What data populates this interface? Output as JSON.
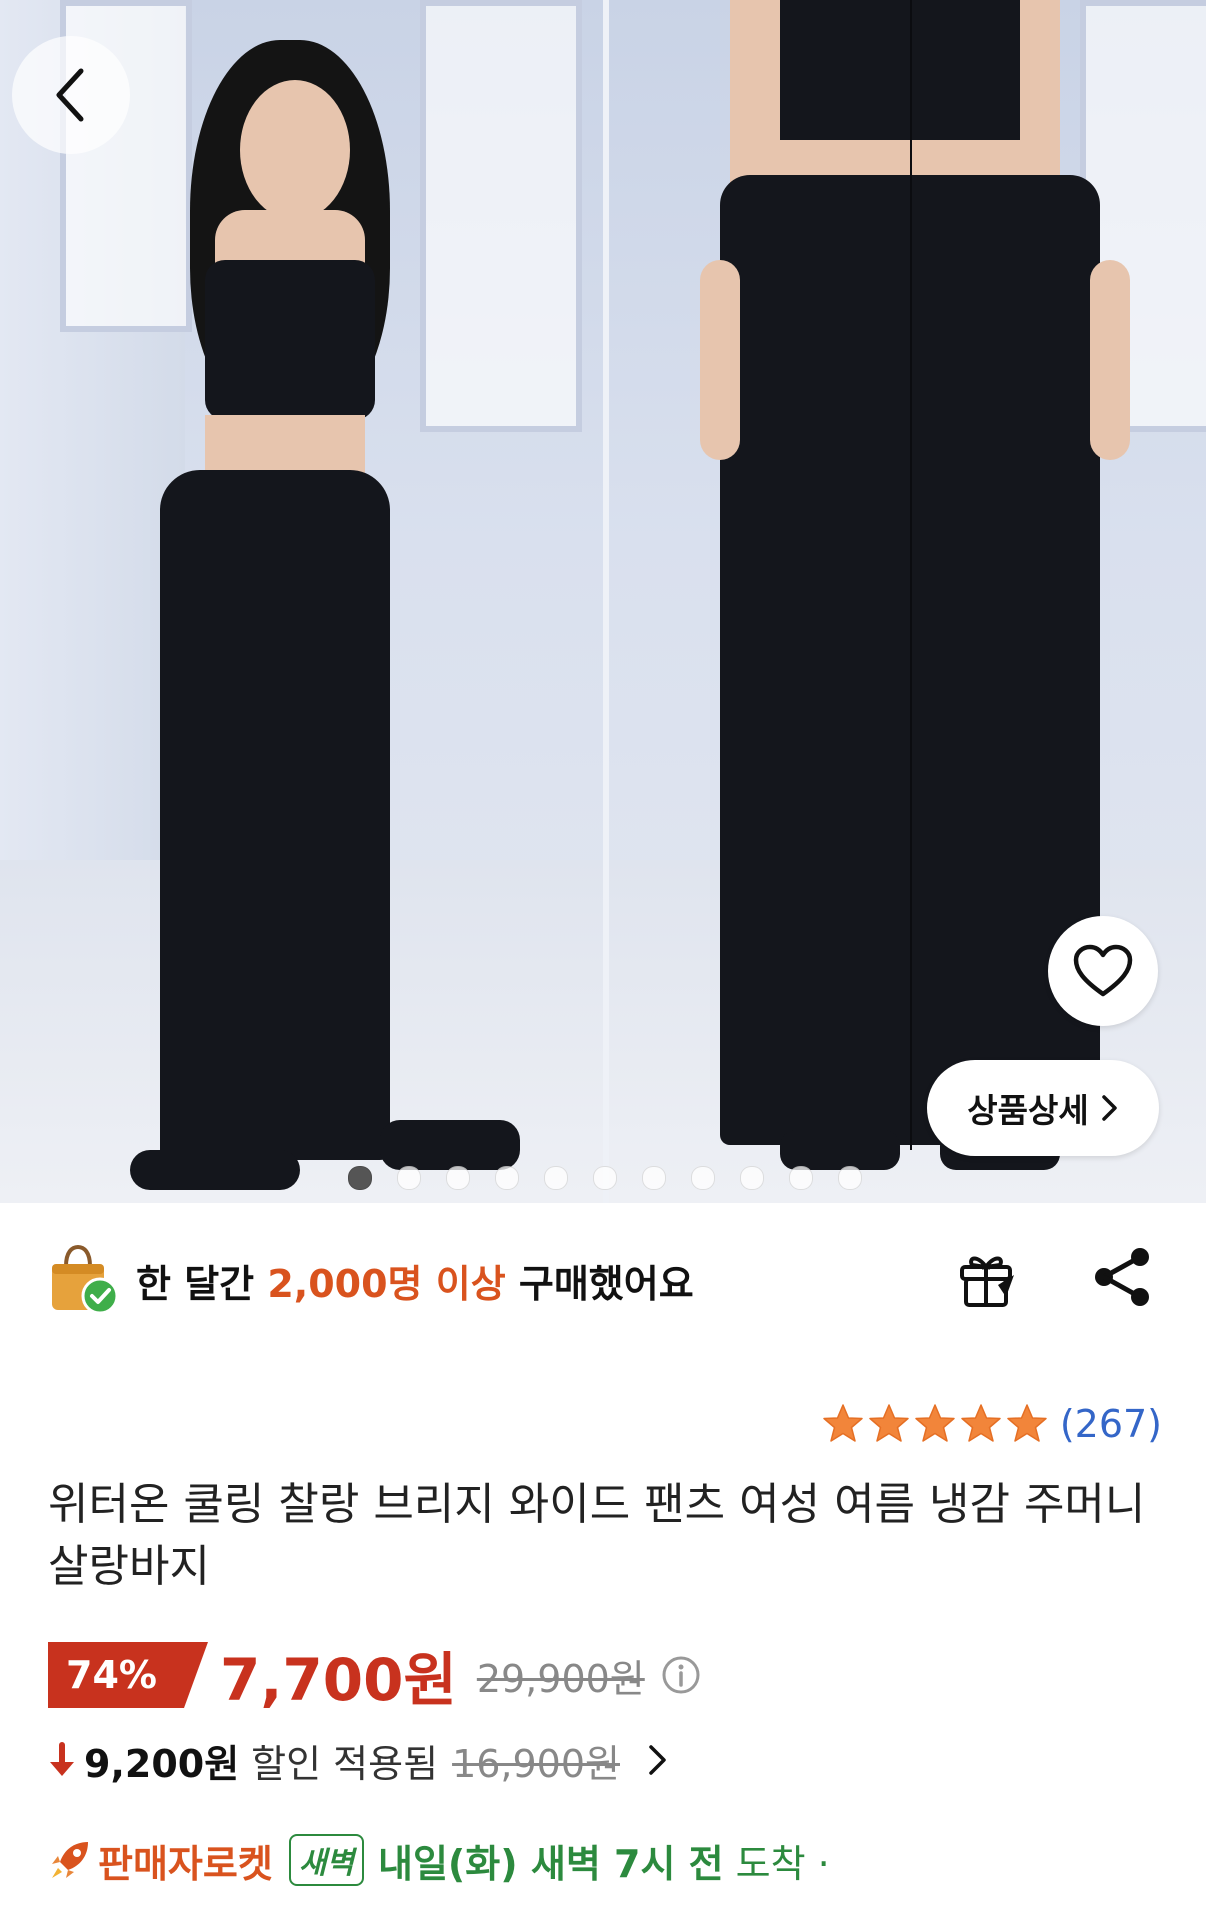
{
  "gallery": {
    "total_images": 11,
    "active_index": 0,
    "detail_button_label": "상품상세"
  },
  "purchase_banner": {
    "prefix": "한 달간 ",
    "highlight": "2,000명 이상",
    "suffix": " 구매했어요"
  },
  "rating": {
    "stars": 5,
    "review_count": "(267)"
  },
  "product": {
    "title": "위터온 쿨링 찰랑 브리지 와이드 팬츠 여성 여름 냉감 주머니 살랑바지"
  },
  "price": {
    "discount_rate": "74%",
    "sale_price": "7,700원",
    "original_price": "29,900원"
  },
  "coupon": {
    "price": "9,200원",
    "label": "할인 적용됨",
    "original": "16,900원"
  },
  "delivery": {
    "seller_rocket": "판매자로켓",
    "badge": "새벽",
    "arrival": "내일(화) 새벽 7시 전",
    "arrival_suffix": "도착 ·"
  },
  "colors": {
    "accent": "#c8321e",
    "highlight_orange": "#d9531e",
    "review_blue": "#3466c8",
    "delivery_green": "#2c8a3e",
    "star": "#f2853a"
  },
  "icons": [
    "back-icon",
    "heart-icon",
    "chevron-right-icon",
    "shopping-bag-check-icon",
    "gift-icon",
    "share-icon",
    "star-icon",
    "info-icon",
    "down-arrow-icon",
    "rocket-icon"
  ]
}
